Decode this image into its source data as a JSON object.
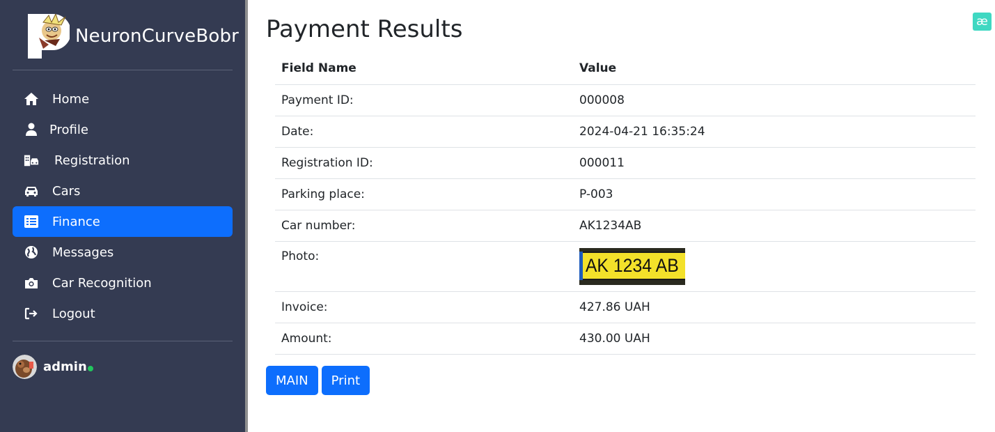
{
  "brand": {
    "title": "NeuronCurveBobr"
  },
  "sidebar": {
    "items": [
      {
        "label": "Home",
        "icon": "home-icon"
      },
      {
        "label": "Profile",
        "icon": "user-icon"
      },
      {
        "label": "Registration",
        "icon": "building-car-icon"
      },
      {
        "label": "Cars",
        "icon": "car-icon"
      },
      {
        "label": "Finance",
        "icon": "list-icon",
        "active": true
      },
      {
        "label": "Messages",
        "icon": "globe-icon"
      },
      {
        "label": "Car Recognition",
        "icon": "camera-icon"
      },
      {
        "label": "Logout",
        "icon": "logout-icon"
      }
    ]
  },
  "user": {
    "name": "admin",
    "status": "online"
  },
  "main": {
    "title": "Payment Results",
    "corner_badge": "æ",
    "table": {
      "headers": [
        "Field Name",
        "Value"
      ],
      "rows": [
        {
          "field": "Payment ID:",
          "value": "000008"
        },
        {
          "field": "Date:",
          "value": "2024-04-21 16:35:24"
        },
        {
          "field": "Registration ID:",
          "value": "000011"
        },
        {
          "field": "Parking place:",
          "value": "P-003"
        },
        {
          "field": "Car number:",
          "value": "AK1234AB"
        },
        {
          "field": "Photo:",
          "value": ""
        },
        {
          "field": "Invoice:",
          "value": "427.86 UAH"
        },
        {
          "field": "Amount:",
          "value": "430.00 UAH"
        }
      ],
      "photo_plate_text": "AK 1234 AB"
    },
    "buttons": {
      "main_label": "MAIN",
      "print_label": "Print"
    }
  },
  "colors": {
    "sidebar_bg": "#343b52",
    "accent": "#0d6efd",
    "online": "#22c55e",
    "badge": "#3fd8c2"
  }
}
